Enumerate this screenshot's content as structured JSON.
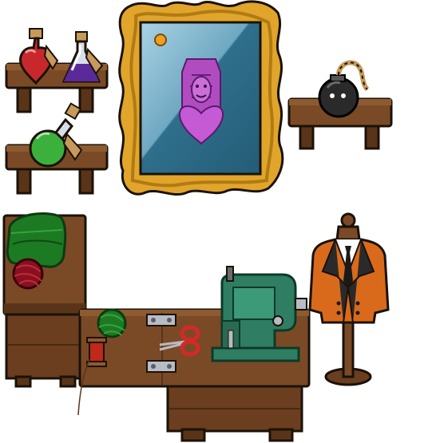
{
  "scene": {
    "name": "tailor-workshop",
    "colors": {
      "outline": "#1a1208",
      "wood": "#7a4a26",
      "wood_light": "#8e5a30",
      "wood_dark": "#5a3418",
      "frame_gold": "#e0a52a",
      "frame_gold_dark": "#b07a14",
      "portrait_bg": "#2f6f8c",
      "portrait_glass": "#8fc0d6",
      "portrait_figure": "#b04cc0",
      "coat_orange": "#d96a1c",
      "sewing_machine": "#2f7d62",
      "fabric_green": "#1c7a22",
      "yarn_red": "#8a1020",
      "potion_red": "#c8282c",
      "potion_purple": "#5a2a9a",
      "potion_green": "#3cb03c",
      "bomb_black": "#2a2a2a",
      "scissors_red": "#d12a2a"
    },
    "icons": [
      "red-heart-potion-icon",
      "purple-potion-icon",
      "green-potion-icon",
      "portrait-frame-icon",
      "bomb-icon",
      "green-fabric-icon",
      "red-yarn-icon",
      "green-yarn-icon",
      "thread-spool-icon",
      "scissors-icon",
      "hinge-icon",
      "sewing-machine-icon",
      "suit-mannequin-icon"
    ]
  }
}
